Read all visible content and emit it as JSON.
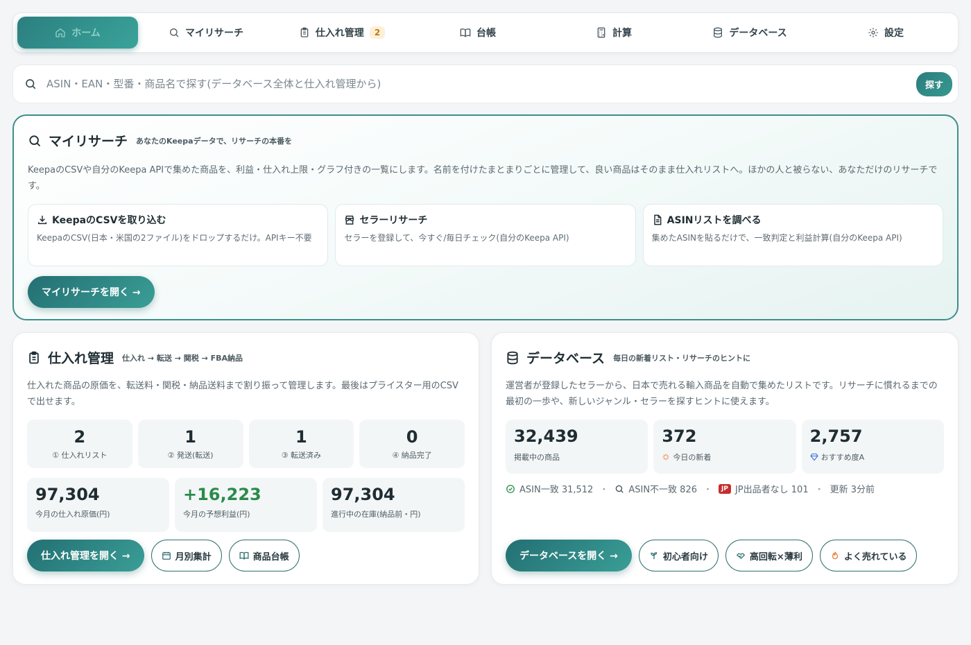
{
  "nav": {
    "items": [
      {
        "label": "ホーム",
        "icon": "home-icon",
        "active": true
      },
      {
        "label": "マイリサーチ",
        "icon": "search-icon"
      },
      {
        "label": "仕入れ管理",
        "icon": "clipboard-icon",
        "badge": "2"
      },
      {
        "label": "台帳",
        "icon": "book-icon"
      },
      {
        "label": "計算",
        "icon": "calculator-icon"
      },
      {
        "label": "データベース",
        "icon": "database-icon"
      },
      {
        "label": "設定",
        "icon": "gear-icon"
      }
    ]
  },
  "search": {
    "placeholder": "ASIN・EAN・型番・商品名で探す(データベース全体と仕入れ管理から)",
    "button": "探す"
  },
  "my_research": {
    "title": "マイリサーチ",
    "subtitle": "あなたのKeepaデータで、リサーチの本番を",
    "description": "KeepaのCSVや自分のKeepa APIで集めた商品を、利益・仕入れ上限・グラフ付きの一覧にします。名前を付けたまとまりごとに管理して、良い商品はそのまま仕入れリストへ。ほかの人と被らない、あなただけのリサーチです。",
    "tools": [
      {
        "title": "KeepaのCSVを取り込む",
        "desc": "KeepaのCSV(日本・米国の2ファイル)をドロップするだけ。APIキー不要",
        "icon": "download-icon"
      },
      {
        "title": "セラーリサーチ",
        "desc": "セラーを登録して、今すぐ/毎日チェック(自分のKeepa API)",
        "icon": "store-icon"
      },
      {
        "title": "ASINリストを調べる",
        "desc": "集めたASINを貼るだけで、一致判定と利益計算(自分のKeepa API)",
        "icon": "document-icon"
      }
    ],
    "open_button": "マイリサーチを開く →"
  },
  "purchase": {
    "title": "仕入れ管理",
    "subtitle": "仕入れ → 転送 → 関税 → FBA納品",
    "description": "仕入れた商品の原価を、転送料・関税・納品送料まで割り振って管理します。最後はプライスター用のCSVで出せます。",
    "stages": [
      {
        "value": "2",
        "label": "① 仕入れリスト"
      },
      {
        "value": "1",
        "label": "② 発送(転送)"
      },
      {
        "value": "1",
        "label": "③ 転送済み"
      },
      {
        "value": "0",
        "label": "④ 納品完了"
      }
    ],
    "totals": [
      {
        "value": "97,304",
        "label": "今月の仕入れ原価(円)"
      },
      {
        "value": "+16,223",
        "label": "今月の予想利益(円)"
      },
      {
        "value": "97,304",
        "label": "進行中の在庫(納品前・円)"
      }
    ],
    "open_button": "仕入れ管理を開く →",
    "monthly_button": "月別集計",
    "ledger_button": "商品台帳"
  },
  "database": {
    "title": "データベース",
    "subtitle": "毎日の新着リスト・リサーチのヒントに",
    "description": "運営者が登録したセラーから、日本で売れる輸入商品を自動で集めたリストです。リサーチに慣れるまでの最初の一歩や、新しいジャンル・セラーを探すヒントに使えます。",
    "stats": [
      {
        "value": "32,439",
        "label": "掲載中の商品"
      },
      {
        "value": "372",
        "label": "今日の新着",
        "icon": "sparkle-icon"
      },
      {
        "value": "2,757",
        "label": "おすすめ度A",
        "icon": "diamond-icon"
      }
    ],
    "meta": {
      "match": "ASIN一致 31,512",
      "mismatch": "ASIN不一致 826",
      "jp_badge": "JP",
      "no_jp_seller": "JP出品者なし 101",
      "updated": "更新 3分前"
    },
    "open_button": "データベースを開く →",
    "filters": [
      "初心者向け",
      "高回転×薄利",
      "よく売れている"
    ]
  },
  "colors": {
    "accent": "#2b7f7f",
    "accent_light": "#3aa39a",
    "badge_orange": "#c07a12",
    "profit_green": "#2a8a4a",
    "jp_red": "#c62d2d"
  }
}
